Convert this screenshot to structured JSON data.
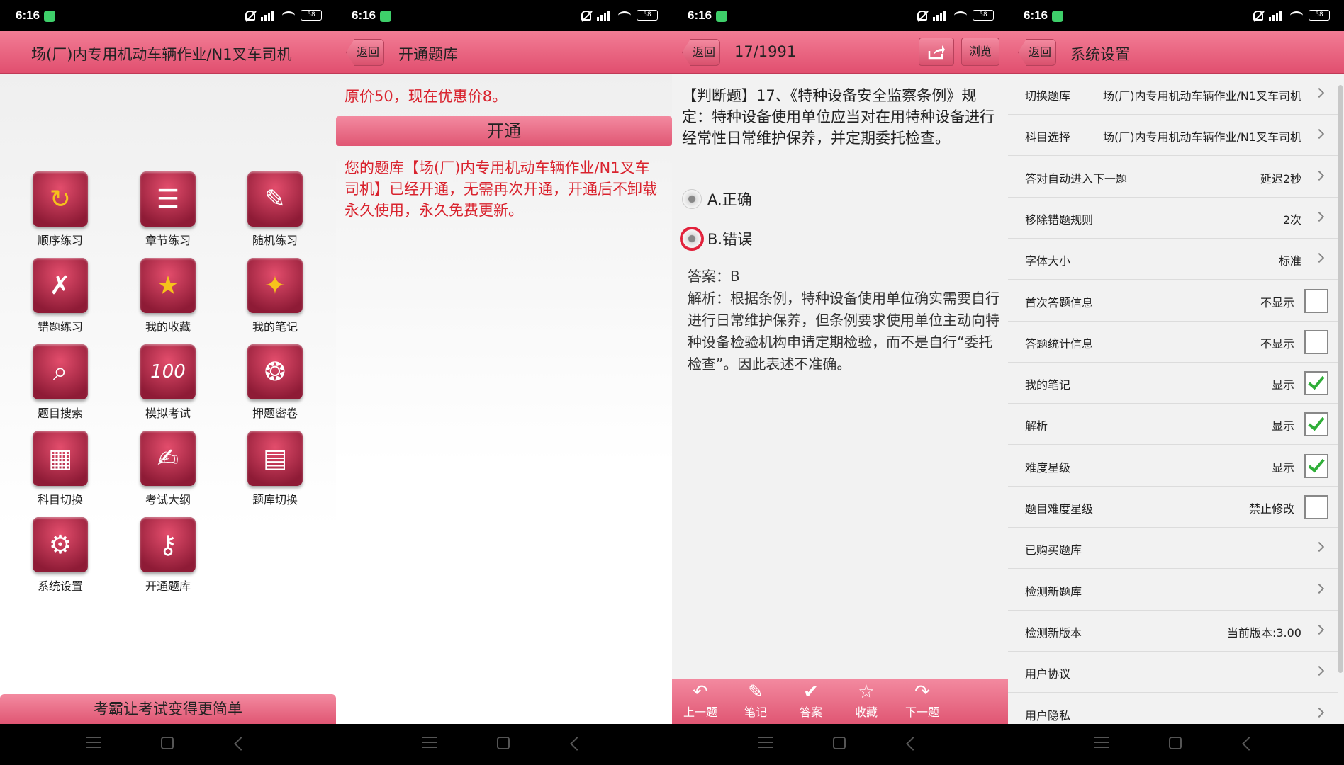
{
  "status": {
    "time": "6:16",
    "battery": "58"
  },
  "screen1": {
    "title": "场(厂)内专用机动车辆作业/N1叉车司机",
    "tiles": [
      {
        "label": "顺序练习",
        "icon": "refresh-icon"
      },
      {
        "label": "章节练习",
        "icon": "list-pen-icon"
      },
      {
        "label": "随机练习",
        "icon": "random-pen-icon"
      },
      {
        "label": "错题练习",
        "icon": "cross-pen-icon"
      },
      {
        "label": "我的收藏",
        "icon": "star-icon"
      },
      {
        "label": "我的笔记",
        "icon": "sparkle-pen-icon"
      },
      {
        "label": "题目搜索",
        "icon": "search-list-icon"
      },
      {
        "label": "模拟考试",
        "icon": "score-100-icon"
      },
      {
        "label": "押题密卷",
        "icon": "brain-icon"
      },
      {
        "label": "科目切换",
        "icon": "grid-icon"
      },
      {
        "label": "考试大纲",
        "icon": "outline-icon"
      },
      {
        "label": "题库切换",
        "icon": "document-icon"
      },
      {
        "label": "系统设置",
        "icon": "gear-icon"
      },
      {
        "label": "开通题库",
        "icon": "key-icon"
      }
    ],
    "slogan": "考霸让考试变得更简单"
  },
  "screen2": {
    "back": "返回",
    "title": "开通题库",
    "price": "原价50，现在优惠价8。",
    "open_button": "开通",
    "notice": "您的题库【场(厂)内专用机动车辆作业/N1叉车司机】已经开通，无需再次开通，开通后不卸载永久使用，永久免费更新。"
  },
  "screen3": {
    "back": "返回",
    "progress": "17/1991",
    "browse": "浏览",
    "question": "【判断题】17、《特种设备安全监察条例》规定：特种设备使用单位应当对在用特种设备进行经常性日常维护保养，并定期委托检查。",
    "option_a": "A.正确",
    "option_b": "B.错误",
    "answer": "答案：B",
    "analysis": "解析：根据条例，特种设备使用单位确实需要自行进行日常维护保养，但条例要求使用单位主动向特种设备检验机构申请定期检验，而不是自行“委托检查”。因此表述不准确。",
    "toolbar": [
      {
        "label": "上一题",
        "icon": "back-arrow-icon"
      },
      {
        "label": "笔记",
        "icon": "edit-icon"
      },
      {
        "label": "答案",
        "icon": "check-icon"
      },
      {
        "label": "收藏",
        "icon": "star-outline-icon"
      },
      {
        "label": "下一题",
        "icon": "forward-arrow-icon"
      }
    ]
  },
  "screen4": {
    "back": "返回",
    "title": "系统设置",
    "rows": [
      {
        "key": "切换题库",
        "value": "场(厂)内专用机动车辆作业/N1叉车司机",
        "type": "chev"
      },
      {
        "key": "科目选择",
        "value": "场(厂)内专用机动车辆作业/N1叉车司机",
        "type": "chev"
      },
      {
        "key": "答对自动进入下一题",
        "value": "延迟2秒",
        "type": "chev"
      },
      {
        "key": "移除错题规则",
        "value": "2次",
        "type": "chev"
      },
      {
        "key": "字体大小",
        "value": "标准",
        "type": "chev"
      },
      {
        "key": "首次答题信息",
        "value": "不显示",
        "type": "cb",
        "checked": false
      },
      {
        "key": "答题统计信息",
        "value": "不显示",
        "type": "cb",
        "checked": false
      },
      {
        "key": "我的笔记",
        "value": "显示",
        "type": "cb",
        "checked": true
      },
      {
        "key": "解析",
        "value": "显示",
        "type": "cb",
        "checked": true
      },
      {
        "key": "难度星级",
        "value": "显示",
        "type": "cb",
        "checked": true
      },
      {
        "key": "题目难度星级",
        "value": "禁止修改",
        "type": "cb",
        "checked": false
      },
      {
        "key": "已购买题库",
        "value": "",
        "type": "chev"
      },
      {
        "key": "检测新题库",
        "value": "",
        "type": "chev"
      },
      {
        "key": "检测新版本",
        "value": "当前版本:3.00",
        "type": "chev"
      },
      {
        "key": "用户协议",
        "value": "",
        "type": "chev"
      },
      {
        "key": "用户隐私",
        "value": "",
        "type": "chev"
      }
    ]
  }
}
